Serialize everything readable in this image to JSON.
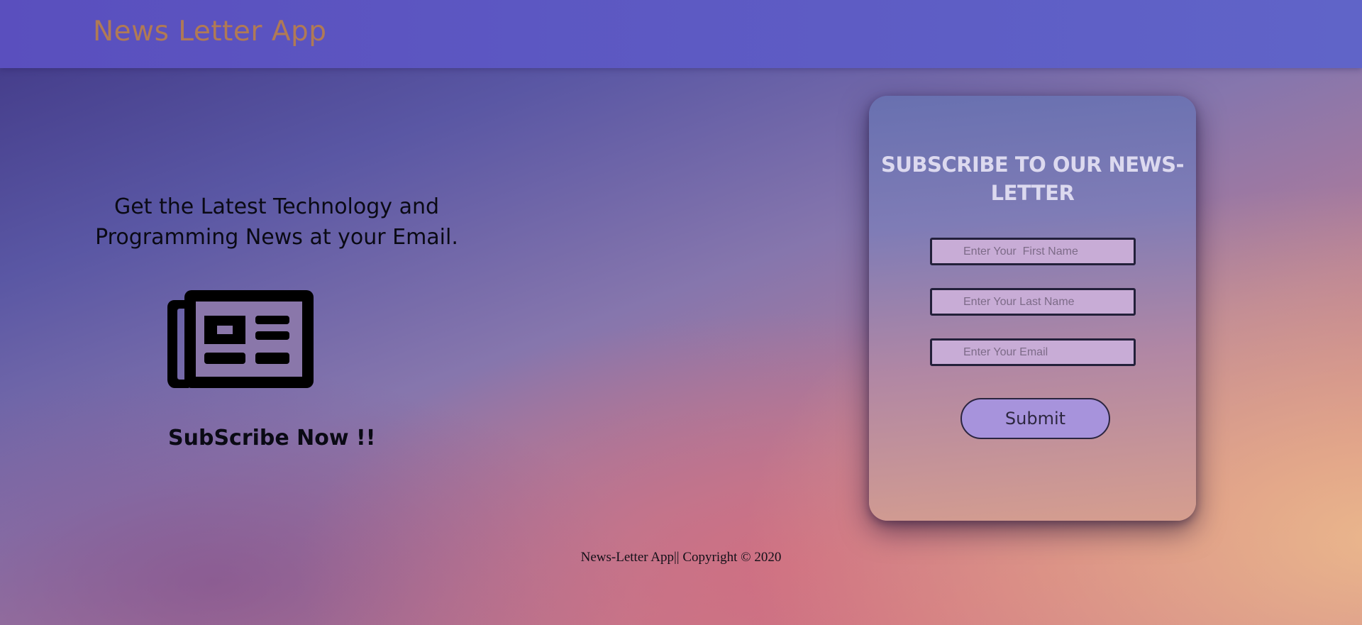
{
  "header": {
    "brand": "News Letter App"
  },
  "hero": {
    "tagline": "Get the Latest Technology and Programming News at your Email.",
    "icon": "newspaper-icon",
    "cta_text": "SubScribe Now !!"
  },
  "form": {
    "title": "SUBSCRIBE TO OUR NEWS-LETTER",
    "first_name_placeholder": "Enter Your  First Name",
    "last_name_placeholder": "Enter Your Last Name",
    "email_placeholder": "Enter Your Email",
    "submit_label": "Submit"
  },
  "footer": {
    "text": "News-Letter App|| Copyright © 2020"
  },
  "colors": {
    "navbar": "#5a4fbe",
    "brand_text": "#b07a55",
    "input_bg": "#c8acd6",
    "submit_bg": "#a793dc"
  }
}
